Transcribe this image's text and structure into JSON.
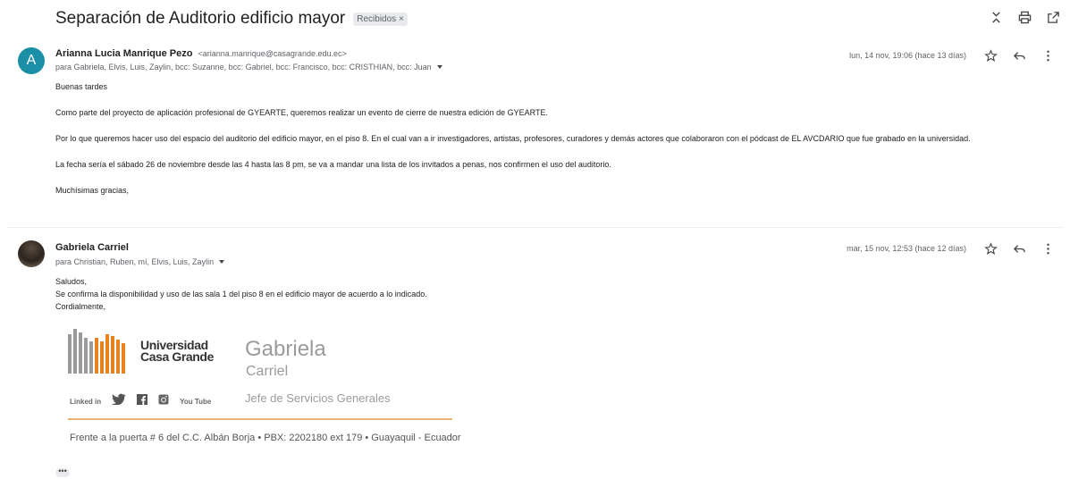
{
  "thread": {
    "subject": "Separación de Auditorio edificio mayor",
    "label": "Recibidos",
    "label_close": "×"
  },
  "top_icons": [
    "expand-collapse-icon",
    "print-icon",
    "open-new-window-icon"
  ],
  "messages": [
    {
      "avatar_letter": "A",
      "sender_name": "Arianna Lucia Manrique Pezo",
      "sender_email": "<arianna.manrique@casagrande.edu.ec>",
      "recipients": "para Gabriela, Elvis, Luis, Zaylin, bcc: Suzanne, bcc: Gabriel, bcc: Francisco, bcc: CRISTHIAN, bcc: Juan",
      "date": "lun, 14 nov, 19:06 (hace 13 días)",
      "body": [
        "Buenas tardes",
        "Como parte del proyecto de aplicación profesional de GYEARTE, queremos realizar un evento de cierre de nuestra edición de GYEARTE.",
        "Por lo que queremos hacer uso del espacio del auditorio del edificio mayor, en el piso 8. En el cual van a ir investigadores, artistas, profesores, curadores y demás actores que colaboraron con el pódcast de EL AVCDARIO que fue grabado en la universidad.",
        "La fecha sería el sábado 26 de noviembre desde las 4 hasta las 8 pm, se va a mandar una lista de los invitados a penas, nos confirmen el uso del auditorio.",
        "Muchísimas gracias,"
      ]
    },
    {
      "sender_name": "Gabriela Carriel",
      "recipients": "para Christian, Ruben, mí, Elvis, Luis, Zaylin",
      "date": "mar, 15 nov, 12:53 (hace 12 días)",
      "body": [
        "Saludos,",
        "Se confirma la disponibilidad y uso de las sala 1 del piso 8 en el edificio mayor de acuerdo a lo indicado.",
        "Cordialmente,"
      ]
    }
  ],
  "signature": {
    "university_line1": "Universidad",
    "university_line2": "Casa Grande",
    "name": "Gabriela",
    "surname": "Carriel",
    "role": "Jefe de Servicios Generales",
    "social": [
      "Linked in",
      "twitter-icon",
      "facebook-icon",
      "instagram-icon",
      "YouTube"
    ],
    "social_linkedin": "Linked in",
    "social_youtube": "You Tube",
    "address": "Frente a la puerta # 6 del C.C. Albán Borja  •  PBX: 2202180 ext 179  •  Guayaquil - Ecuador",
    "accent_color": "#e8b36f",
    "logo_orange": "#e8821e",
    "logo_gray": "#9a9a9a"
  },
  "more_label": "•••",
  "colors": {
    "avatar_a": "#1a8fa6",
    "label_bg": "#e8eaed"
  }
}
